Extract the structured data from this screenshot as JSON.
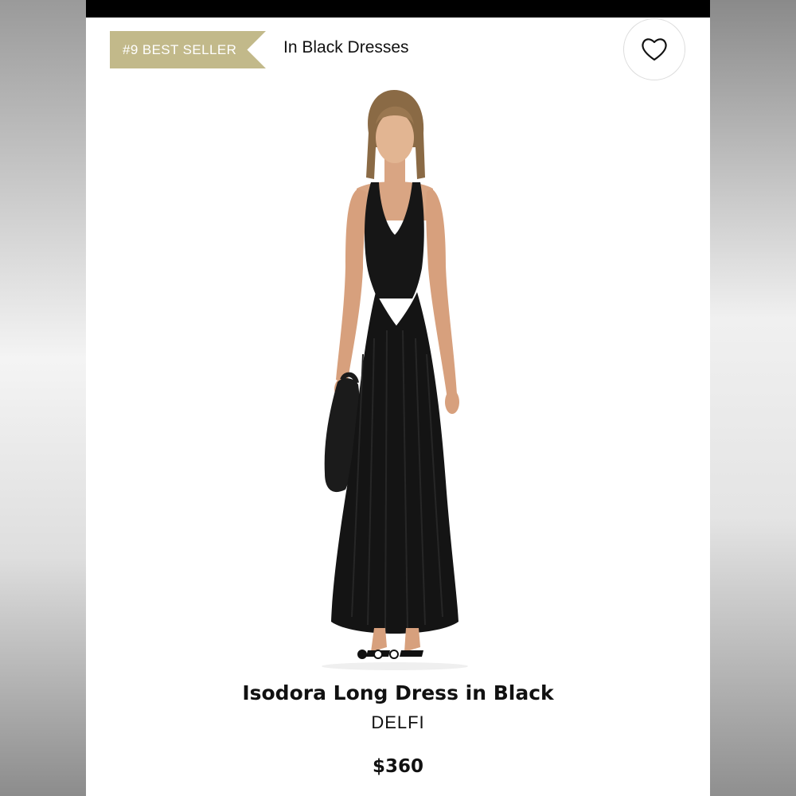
{
  "badge": {
    "text": "#9 BEST SELLER",
    "color": "#c2b98a"
  },
  "category": {
    "text": "In Black Dresses"
  },
  "favorite": {
    "icon": "heart-outline-icon"
  },
  "product": {
    "image_alt": "Model wearing black long dress holding black handbag",
    "title": "Isodora Long Dress in Black",
    "brand": "DELFI",
    "price": "$360"
  },
  "carousel": {
    "total": 3,
    "active_index": 0
  }
}
